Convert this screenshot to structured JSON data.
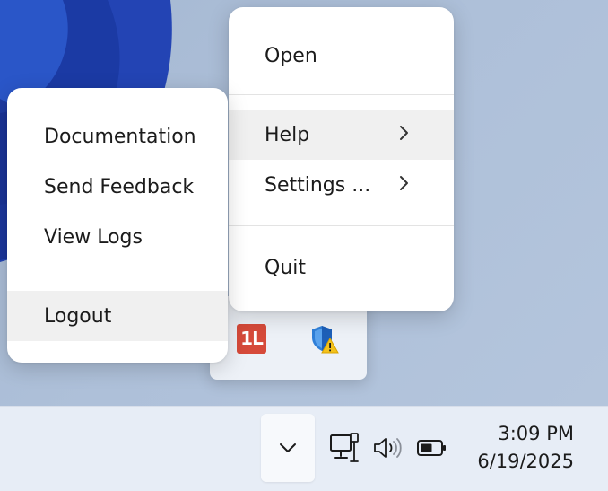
{
  "main_menu": {
    "open": "Open",
    "help": "Help",
    "settings": "Settings ...",
    "quit": "Quit"
  },
  "help_submenu": {
    "documentation": "Documentation",
    "send_feedback": "Send Feedback",
    "view_logs": "View Logs",
    "logout": "Logout"
  },
  "tray_overflow": {
    "app_icon_letters": "1L",
    "icons": [
      "app-red-icon",
      "security-shield-warning-icon"
    ]
  },
  "taskbar": {
    "icons": [
      "chevron-down-icon",
      "network-icon",
      "volume-icon",
      "battery-icon"
    ],
    "time": "3:09 PM",
    "date": "6/19/2025"
  },
  "colors": {
    "highlight": "#f0f0f0",
    "app_red": "#d64a3a",
    "shield_blue": "#2f7fd8",
    "warning_yellow": "#f4c21b"
  }
}
